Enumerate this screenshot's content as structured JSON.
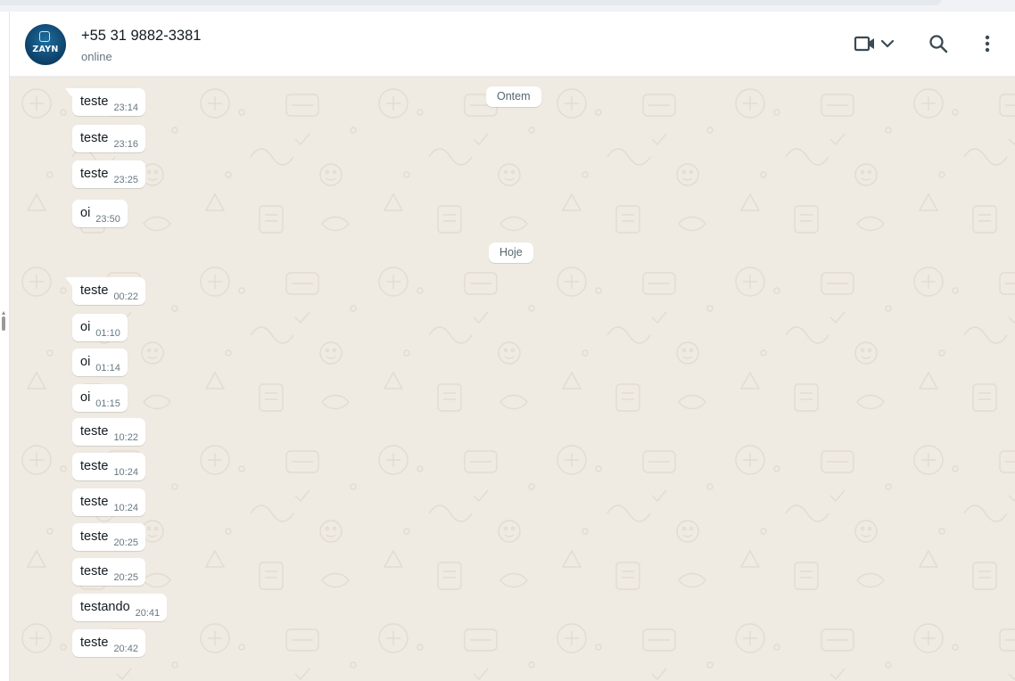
{
  "header": {
    "avatar_text": "ZAYN",
    "contact_name": "+55 31 9882-3381",
    "status": "online",
    "icons": [
      "video-call-icon",
      "chevron-down-icon",
      "search-icon",
      "more-vertical-icon"
    ]
  },
  "chat": {
    "date_separators": [
      "Ontem",
      "Hoje"
    ],
    "messages_yesterday": [
      {
        "text": "teste",
        "time": "23:14"
      },
      {
        "text": "teste",
        "time": "23:16"
      },
      {
        "text": "teste",
        "time": "23:25"
      },
      {
        "text": "oi",
        "time": "23:50"
      }
    ],
    "messages_today": [
      {
        "text": "teste",
        "time": "00:22"
      },
      {
        "text": "oi",
        "time": "01:10"
      },
      {
        "text": "oi",
        "time": "01:14"
      },
      {
        "text": "oi",
        "time": "01:15"
      },
      {
        "text": "teste",
        "time": "10:22"
      },
      {
        "text": "teste",
        "time": "10:24"
      },
      {
        "text": "teste",
        "time": "10:24"
      },
      {
        "text": "teste",
        "time": "20:25"
      },
      {
        "text": "teste",
        "time": "20:25"
      },
      {
        "text": "testando",
        "time": "20:41"
      },
      {
        "text": "teste",
        "time": "20:42"
      }
    ]
  },
  "colors": {
    "chat_background": "#efeae2",
    "bubble_incoming": "#ffffff",
    "header_background": "#ffffff",
    "avatar_background": "#0d3f66"
  }
}
